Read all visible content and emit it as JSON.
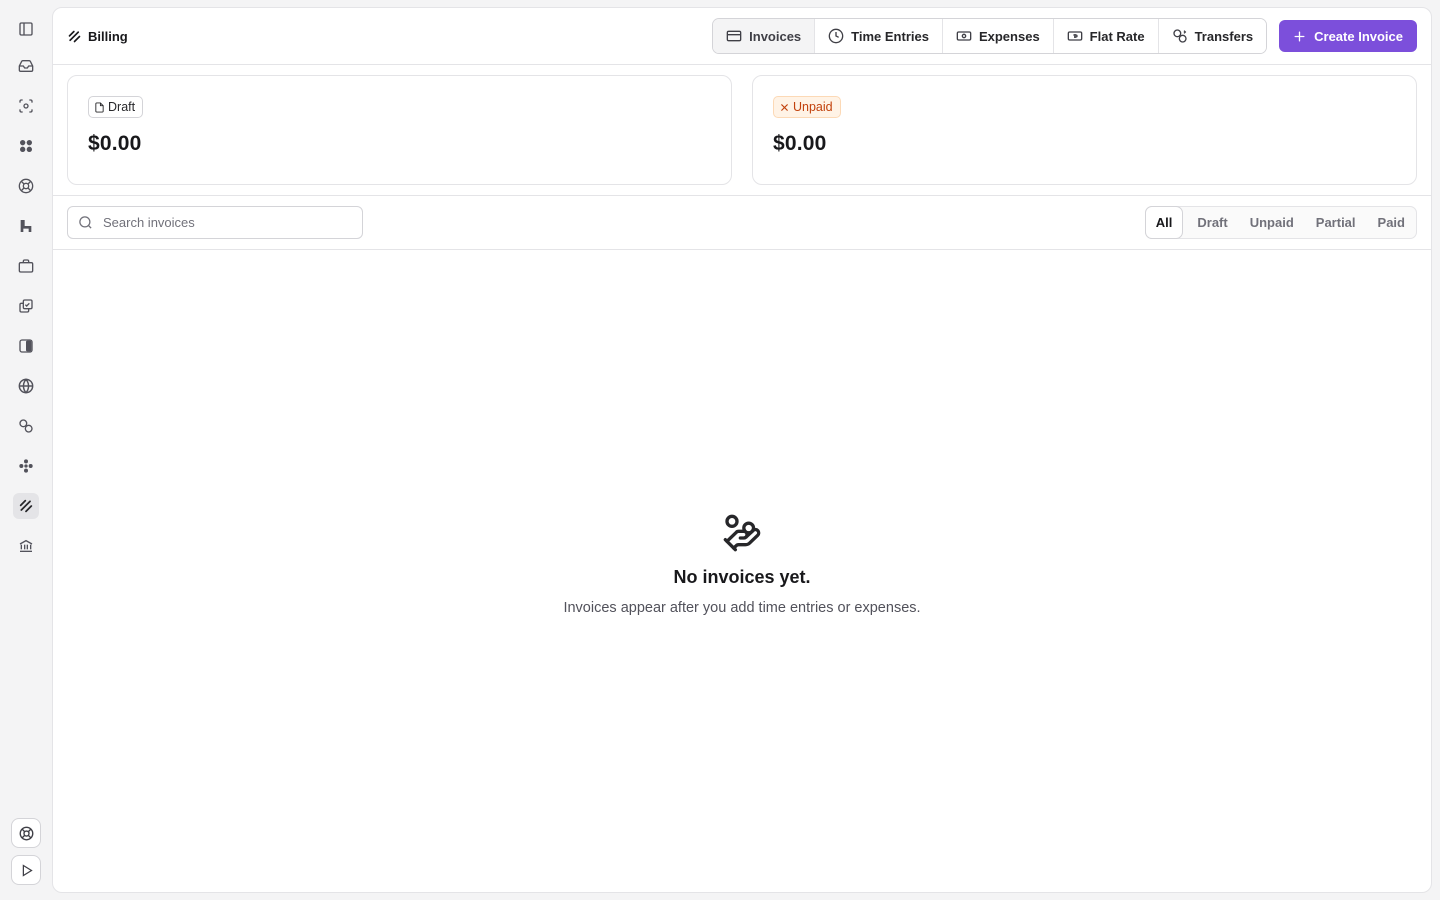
{
  "breadcrumb": {
    "label": "Billing"
  },
  "tabs": [
    {
      "label": "Invoices",
      "icon": "invoice-icon"
    },
    {
      "label": "Time Entries",
      "icon": "clock-icon"
    },
    {
      "label": "Expenses",
      "icon": "banknote-icon"
    },
    {
      "label": "Flat Rate",
      "icon": "flat-rate-icon"
    },
    {
      "label": "Transfers",
      "icon": "transfer-icon"
    }
  ],
  "active_tab": "Invoices",
  "create_button": {
    "label": "Create Invoice",
    "color": "#7c4fdb"
  },
  "summary": {
    "draft": {
      "badge": "Draft",
      "amount": "$0.00"
    },
    "unpaid": {
      "badge": "Unpaid",
      "amount": "$0.00",
      "color": "#c2410c"
    }
  },
  "search": {
    "placeholder": "Search invoices",
    "value": ""
  },
  "status_filters": [
    "All",
    "Draft",
    "Unpaid",
    "Partial",
    "Paid"
  ],
  "active_status": "All",
  "empty_state": {
    "title": "No invoices yet.",
    "subtitle": "Invoices appear after you add time entries or expenses.",
    "icon": "hand-coins-icon"
  }
}
